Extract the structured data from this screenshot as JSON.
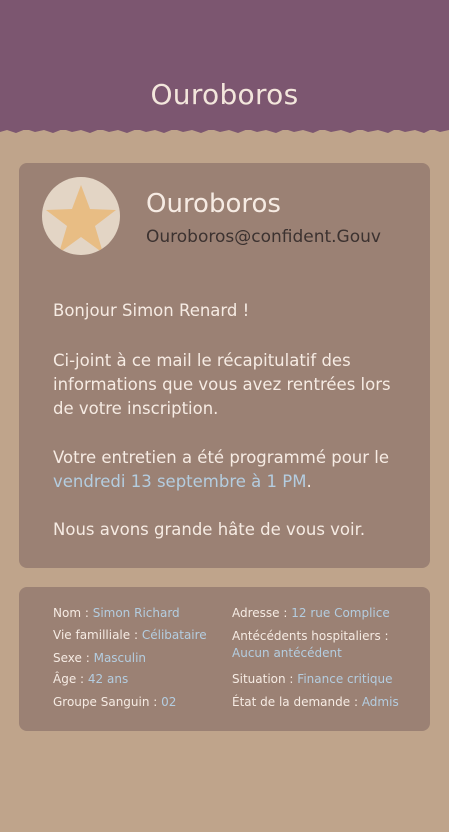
{
  "header": {
    "title": "Ouroboros"
  },
  "message": {
    "sender_name": "Ouroboros",
    "sender_email": "Ouroboros@confident.Gouv",
    "avatar_icon": "star-icon",
    "greeting": "Bonjour Simon Renard !",
    "recap": "Ci-joint à ce mail le récapitulatif des informations que vous avez rentrées lors de votre inscription.",
    "meeting_prefix": "Votre entretien a été programmé pour le",
    "meeting_date": "vendredi 13 septembre à 1 PM",
    "meeting_suffix": ".",
    "closing": "Nous avons grande hâte de vous voir."
  },
  "info": {
    "left": [
      {
        "label": "Nom :",
        "value": "Simon Richard"
      },
      {
        "label": "Vie familliale :",
        "value": "Célibataire"
      },
      {
        "label": "Sexe :",
        "value": "Masculin"
      },
      {
        "label": "Âge :",
        "value": "42 ans"
      },
      {
        "label": "Groupe Sanguin :",
        "value": "02"
      }
    ],
    "right": [
      {
        "label": "Adresse :",
        "value": "12 rue Complice"
      },
      {
        "label": "Antécédents hospitaliers :",
        "value": "Aucun antécédent"
      },
      {
        "label": "Situation :",
        "value": "Finance critique"
      },
      {
        "label": "État de la demande :",
        "value": "Admis"
      }
    ]
  },
  "colors": {
    "header_bg": "#7c5670",
    "page_bg": "#bfa48b",
    "card_bg": "#9b8174",
    "accent": "#b4cde0",
    "star": "#e8bd84"
  }
}
